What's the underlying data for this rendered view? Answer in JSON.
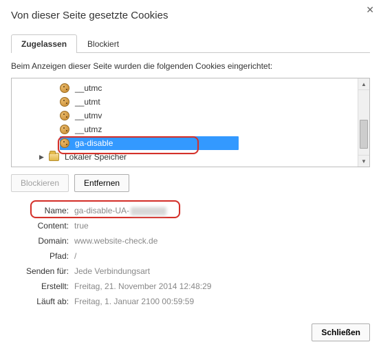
{
  "title": "Von dieser Seite gesetzte Cookies",
  "tabs": {
    "allowed": "Zugelassen",
    "blocked": "Blockiert"
  },
  "intro": "Beim Anzeigen dieser Seite wurden die folgenden Cookies eingerichtet:",
  "tree": {
    "items": [
      "__utmc",
      "__utmt",
      "__utmv",
      "__utmz",
      "ga-disable"
    ],
    "folder": "Lokaler Speicher"
  },
  "buttons": {
    "block": "Blockieren",
    "remove": "Entfernen",
    "close": "Schließen"
  },
  "details": {
    "labels": {
      "name": "Name:",
      "content": "Content:",
      "domain": "Domain:",
      "path": "Pfad:",
      "sendfor": "Senden für:",
      "created": "Erstellt:",
      "expires": "Läuft ab:"
    },
    "values": {
      "name": "ga-disable-UA-",
      "content": "true",
      "domain": "www.website-check.de",
      "path": "/",
      "sendfor": "Jede Verbindungsart",
      "created": "Freitag, 21. November 2014 12:48:29",
      "expires": "Freitag, 1. Januar 2100 00:59:59"
    }
  }
}
